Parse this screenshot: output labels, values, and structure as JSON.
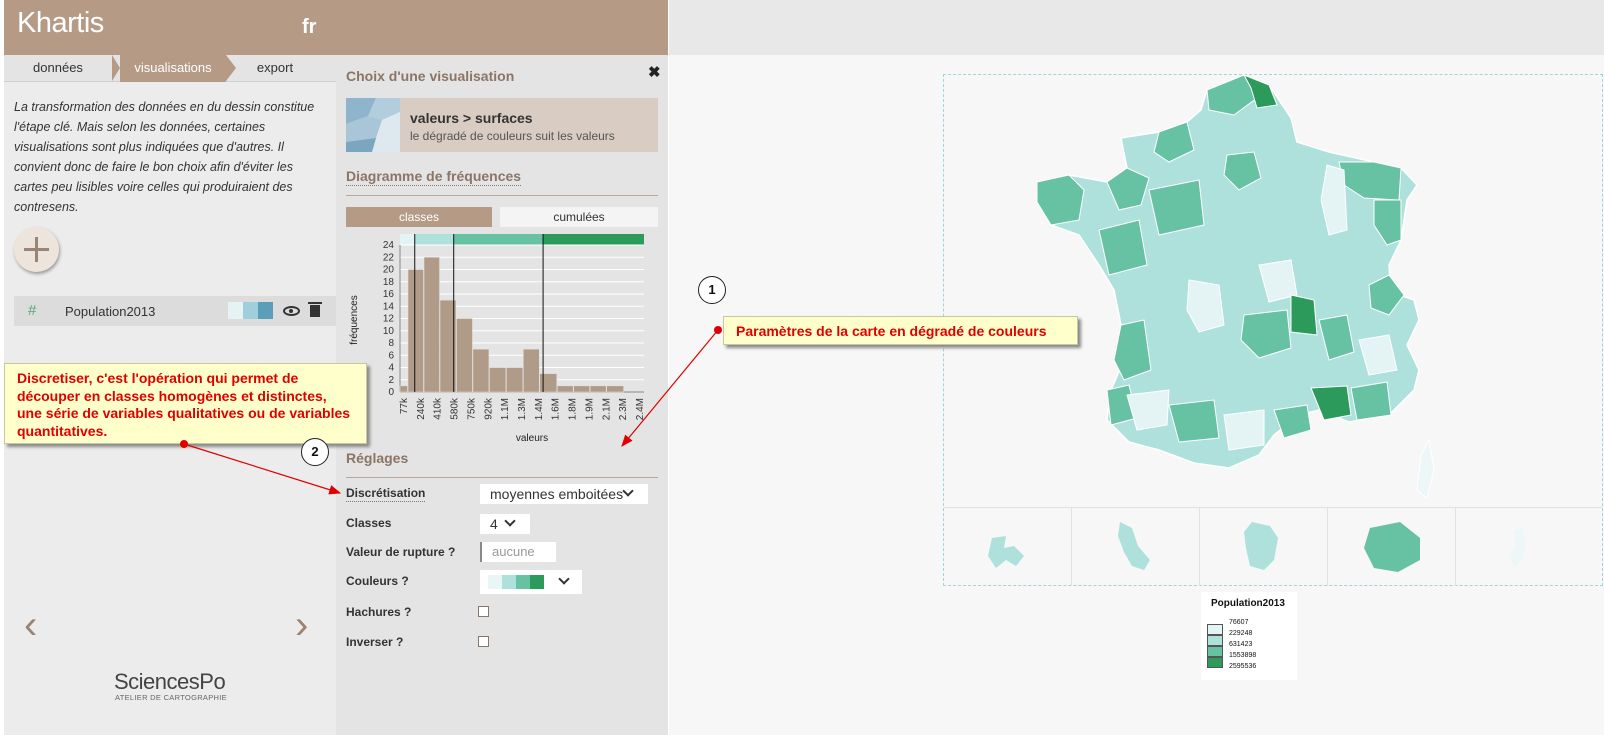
{
  "app": {
    "logo": "Khartis",
    "language": "fr"
  },
  "nav_tabs": [
    {
      "label": "données",
      "active": false
    },
    {
      "label": "visualisations",
      "active": true
    },
    {
      "label": "export",
      "active": false
    }
  ],
  "left_panel": {
    "intro": "La transformation des données en du dessin constitue l'étape clé. Mais selon les données, certaines visualisations sont plus indiquées que d'autres. Il convient donc de faire le bon choix afin d'éviter les cartes peu lisibles voire celles qui produiraient des contresens.",
    "add_icon": "plus-icon",
    "layer": {
      "hash": "#",
      "name": "Population2013",
      "swatch_colors": [
        "#e5f3f5",
        "#9fcfdb",
        "#5b9eb9"
      ],
      "icons": [
        "eye-icon",
        "trash-icon"
      ]
    },
    "prev_arrow": "‹",
    "next_arrow": "›",
    "footer_logo": "SciencesPo",
    "footer_sub": "ATELIER DE CARTOGRAPHIE"
  },
  "right_panel": {
    "title": "Choix d'une visualisation",
    "close": "✖",
    "visualization": {
      "title": "valeurs > surfaces",
      "subtitle": "le dégradé de couleurs suit les valeurs"
    },
    "freq_title": "Diagramme de fréquences",
    "toggle_classes": "classes",
    "toggle_cumulees": "cumulées",
    "settings_title": "Réglages",
    "settings": {
      "discretisation_label": "Discrétisation",
      "discretisation_value": "moyennes emboitées",
      "classes_label": "Classes",
      "classes_value": "4",
      "rupture_label": "Valeur de rupture ?",
      "rupture_placeholder": "aucune",
      "couleurs_label": "Couleurs ?",
      "couleurs_swatches": [
        "#e8f6f6",
        "#aee0dc",
        "#67c1a3",
        "#2b9a5b"
      ],
      "hachures_label": "Hachures ?",
      "inverser_label": "Inverser ?"
    }
  },
  "chart_data": {
    "type": "bar",
    "xlabel": "valeurs",
    "ylabel": "fréquences",
    "ylim": [
      0,
      24
    ],
    "yticks": [
      0,
      2,
      4,
      6,
      8,
      10,
      12,
      14,
      16,
      18,
      20,
      22,
      24
    ],
    "xtick_labels": [
      "77k",
      "240k",
      "410k",
      "580k",
      "750k",
      "920k",
      "1.1M",
      "1.3M",
      "1.4M",
      "1.6M",
      "1.8M",
      "1.9M",
      "2.1M",
      "2.3M",
      "2.4M"
    ],
    "bins": [
      {
        "x0": 77000,
        "x1": 160000,
        "y": 1
      },
      {
        "x0": 160000,
        "x1": 325000,
        "y": 20
      },
      {
        "x0": 325000,
        "x1": 490000,
        "y": 22
      },
      {
        "x0": 490000,
        "x1": 660000,
        "y": 15
      },
      {
        "x0": 660000,
        "x1": 830000,
        "y": 12
      },
      {
        "x0": 830000,
        "x1": 1000000,
        "y": 7
      },
      {
        "x0": 1000000,
        "x1": 1175000,
        "y": 4
      },
      {
        "x0": 1175000,
        "x1": 1350000,
        "y": 4
      },
      {
        "x0": 1350000,
        "x1": 1520000,
        "y": 7
      },
      {
        "x0": 1520000,
        "x1": 1700000,
        "y": 3
      },
      {
        "x0": 1700000,
        "x1": 1870000,
        "y": 1
      },
      {
        "x0": 1870000,
        "x1": 2040000,
        "y": 1
      },
      {
        "x0": 2040000,
        "x1": 2210000,
        "y": 1
      },
      {
        "x0": 2210000,
        "x1": 2390000,
        "y": 1
      }
    ],
    "class_breaks": [
      229248,
      631423,
      1553898
    ],
    "class_colors": [
      "#e4f4f4",
      "#aee0dc",
      "#67c1a3",
      "#2b9a5b"
    ],
    "xlim": [
      77000,
      2595536
    ]
  },
  "map": {
    "legend_title": "Population2013",
    "legend_values": [
      "76607",
      "229248",
      "631423",
      "1553898",
      "2595536"
    ],
    "legend_colors": [
      "#e4f4f4",
      "#aee0dc",
      "#67c1a3",
      "#2b9a5b"
    ]
  },
  "annotations": {
    "callout1": "Paramètres de la carte en dégradé de couleurs",
    "callout2": "Discretiser, c'est l'opération qui permet de découper en classes homogènes et distinctes, une série de variables qualitatives ou de variables quantitatives.",
    "num1": "1",
    "num2": "2"
  }
}
